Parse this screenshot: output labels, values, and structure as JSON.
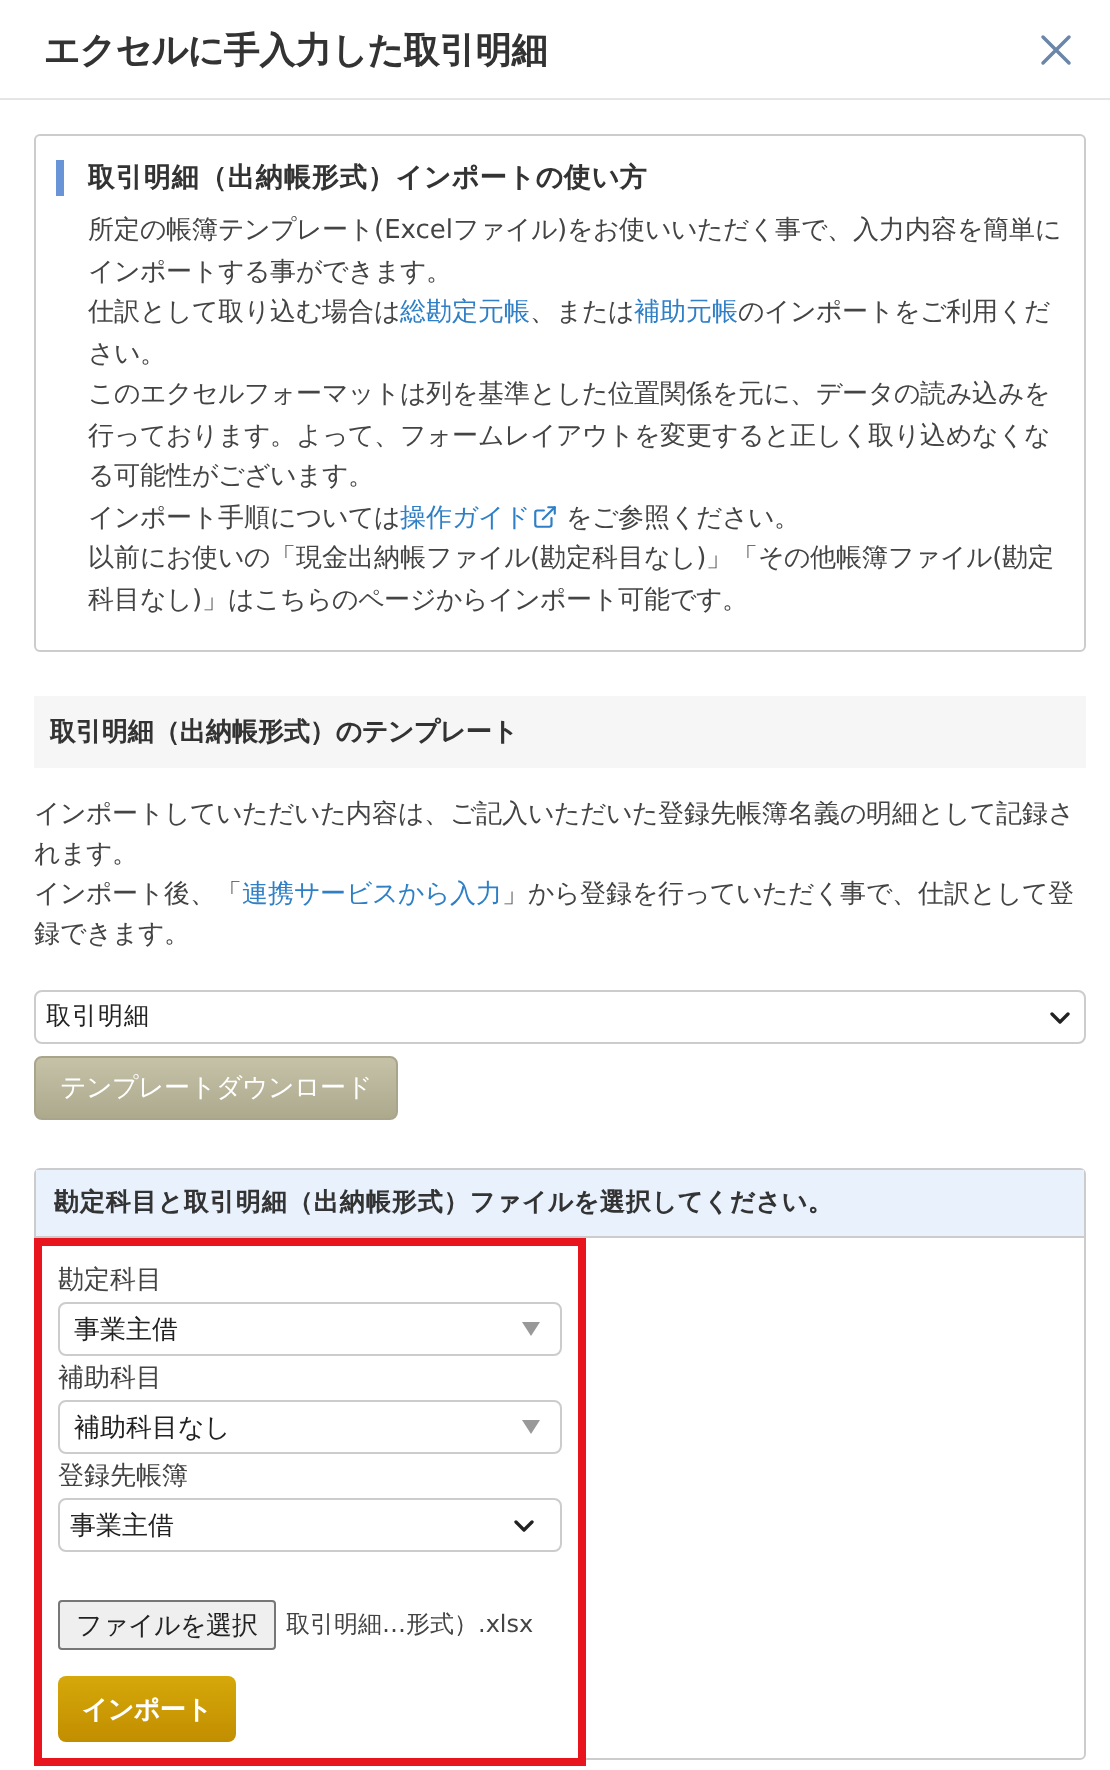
{
  "dialog": {
    "title": "エクセルに手入力した取引明細"
  },
  "help": {
    "title": "取引明細（出納帳形式）インポートの使い方",
    "paragraphs": [
      [
        {
          "kind": "text",
          "text": "所定の帳簿テンプレート(Excelファイル)をお使いいただく事で、入力内容を簡単にインポートする事ができます。"
        }
      ],
      [
        {
          "kind": "text",
          "text": "仕訳として取り込む場合は"
        },
        {
          "kind": "link",
          "text": "総勘定元帳"
        },
        {
          "kind": "text",
          "text": "、または"
        },
        {
          "kind": "link",
          "text": "補助元帳"
        },
        {
          "kind": "text",
          "text": "のインポートをご利用ください。"
        }
      ],
      [
        {
          "kind": "text",
          "text": "このエクセルフォーマットは列を基準とした位置関係を元に、データの読み込みを行っております。よって、フォームレイアウトを変更すると正しく取り込めなくなる可能性がございます。"
        }
      ],
      [
        {
          "kind": "text",
          "text": "インポート手順については"
        },
        {
          "kind": "external",
          "text": "操作ガイド"
        },
        {
          "kind": "text",
          "text": "をご参照ください。"
        }
      ],
      [
        {
          "kind": "text",
          "text": "以前にお使いの「現金出納帳ファイル(勘定科目なし)」「その他帳簿ファイル(勘定科目なし)」はこちらのページからインポート可能です。"
        }
      ]
    ]
  },
  "template": {
    "heading": "取引明細（出納帳形式）のテンプレート",
    "paragraphs": [
      [
        {
          "kind": "text",
          "text": "インポートしていただいた内容は、ご記入いただいた登録先帳簿名義の明細として記録されます。"
        }
      ],
      [
        {
          "kind": "text",
          "text": "インポート後、「"
        },
        {
          "kind": "link",
          "text": "連携サービスから入力"
        },
        {
          "kind": "text",
          "text": "」から登録を行っていただく事で、仕訳として登録できます。"
        }
      ]
    ],
    "select": "取引明細",
    "button": "テンプレートダウンロード"
  },
  "upload": {
    "heading": "勘定科目と取引明細（出納帳形式）ファイルを選択してください。",
    "highlighted": true,
    "fields": [
      {
        "label": "勘定科目",
        "value": "事業主借",
        "kind": "combo"
      },
      {
        "label": "補助科目",
        "value": "補助科目なし",
        "kind": "combo"
      },
      {
        "label": "登録先帳簿",
        "value": "事業主借",
        "kind": "native"
      }
    ],
    "file_button": "ファイルを選択",
    "file_name": "取引明細…形式）.xlsx",
    "import_button": "インポート"
  }
}
